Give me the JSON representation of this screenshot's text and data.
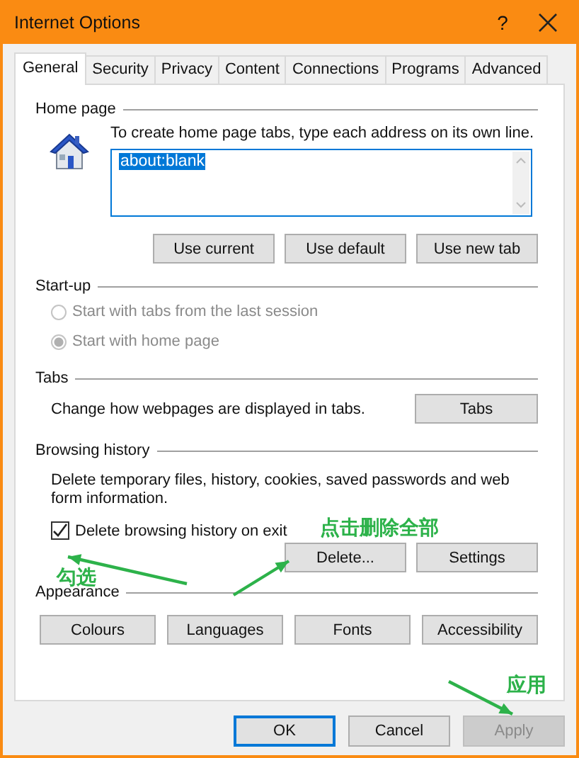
{
  "window": {
    "title": "Internet Options",
    "help": "?"
  },
  "tabs": [
    {
      "label": "General",
      "selected": true
    },
    {
      "label": "Security",
      "selected": false
    },
    {
      "label": "Privacy",
      "selected": false
    },
    {
      "label": "Content",
      "selected": false
    },
    {
      "label": "Connections",
      "selected": false
    },
    {
      "label": "Programs",
      "selected": false
    },
    {
      "label": "Advanced",
      "selected": false
    }
  ],
  "home_page": {
    "heading": "Home page",
    "description": "To create home page tabs, type each address on its own line.",
    "value": "about:blank",
    "value_selected": true,
    "buttons": [
      "Use current",
      "Use default",
      "Use new tab"
    ]
  },
  "startup": {
    "heading": "Start-up",
    "options": [
      {
        "label": "Start with tabs from the last session",
        "selected": false,
        "disabled": true
      },
      {
        "label": "Start with home page",
        "selected": true,
        "disabled": true
      }
    ]
  },
  "tabs_section": {
    "heading": "Tabs",
    "description": "Change how webpages are displayed in tabs.",
    "button": "Tabs"
  },
  "browsing_history": {
    "heading": "Browsing history",
    "description": "Delete temporary files, history, cookies, saved passwords and web form information.",
    "checkbox": {
      "label": "Delete browsing history on exit",
      "checked": true
    },
    "buttons": [
      "Delete...",
      "Settings"
    ]
  },
  "appearance": {
    "heading": "Appearance",
    "buttons": [
      "Colours",
      "Languages",
      "Fonts",
      "Accessibility"
    ]
  },
  "footer_buttons": [
    {
      "label": "OK",
      "default": true,
      "disabled": false
    },
    {
      "label": "Cancel",
      "default": false,
      "disabled": false
    },
    {
      "label": "Apply",
      "default": false,
      "disabled": true
    }
  ],
  "annotations": [
    {
      "text": "点击删除全部"
    },
    {
      "text": "勾选"
    },
    {
      "text": "应用"
    }
  ]
}
